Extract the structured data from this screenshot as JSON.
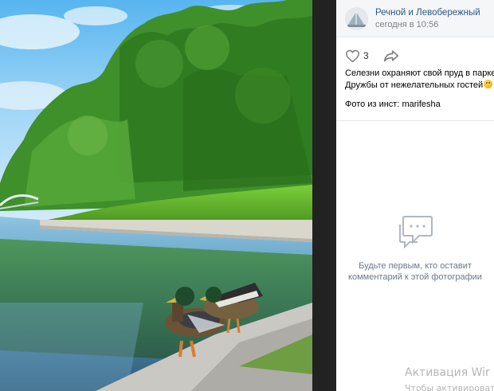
{
  "post": {
    "author": "Речной и Левобережный",
    "time": "сегодня в 10:56",
    "likes": "3",
    "caption_line1": "Селезни охраняют свой пруд в парке",
    "caption_line2": "Дружбы от нежелательных гостей",
    "credit": "Фото из инст: marifesha"
  },
  "comments": {
    "empty_line1": "Будьте первым, кто оставит",
    "empty_line2": "комментарий к этой фотографии"
  },
  "watermark": {
    "line1": "Активация Wir",
    "line2": "Чтобы активироват"
  },
  "icons": {
    "like": "heart-outline-icon",
    "share": "share-arrow-icon",
    "comment": "comment-bubble-icon",
    "emoji": "smiling-face-emoji"
  },
  "colors": {
    "author_link": "#2a5885",
    "muted": "#828282",
    "icon": "#828282",
    "comment_icon": "#aeb7c2"
  }
}
